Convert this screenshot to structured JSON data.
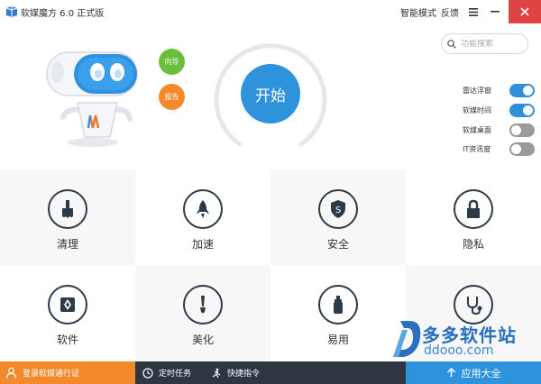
{
  "window": {
    "title": "软媒魔方 6.0 正式版",
    "smart_mode": "智能模式",
    "feedback": "反馈"
  },
  "search": {
    "placeholder": "功能搜索"
  },
  "side_buttons": {
    "guide": "向导",
    "report": "报告"
  },
  "start_button": "开始",
  "toggles": [
    {
      "label": "雷达浮窗",
      "on": true
    },
    {
      "label": "软媒时间",
      "on": true
    },
    {
      "label": "软媒桌面",
      "on": false
    },
    {
      "label": "IT资讯窗",
      "on": false
    }
  ],
  "tiles": [
    {
      "label": "清理",
      "icon": "brush-icon"
    },
    {
      "label": "加速",
      "icon": "rocket-icon"
    },
    {
      "label": "安全",
      "icon": "shield-icon"
    },
    {
      "label": "隐私",
      "icon": "lock-icon"
    },
    {
      "label": "软件",
      "icon": "aperture-icon"
    },
    {
      "label": "美化",
      "icon": "paintbrush-icon"
    },
    {
      "label": "易用",
      "icon": "bottle-icon"
    },
    {
      "label": "",
      "icon": "stethoscope-icon"
    }
  ],
  "bottom_bar": {
    "login": "登录软媒通行证",
    "timer": "定时任务",
    "shortcut": "快捷指令",
    "apps": "应用大全"
  },
  "watermark": {
    "cn": "多多软件站",
    "en": "ddooo.com"
  },
  "colors": {
    "accent_blue": "#2f93dc",
    "orange": "#f28a2c",
    "green": "#6cbf3c",
    "dark": "#2e3642",
    "close_red": "#e04343"
  }
}
